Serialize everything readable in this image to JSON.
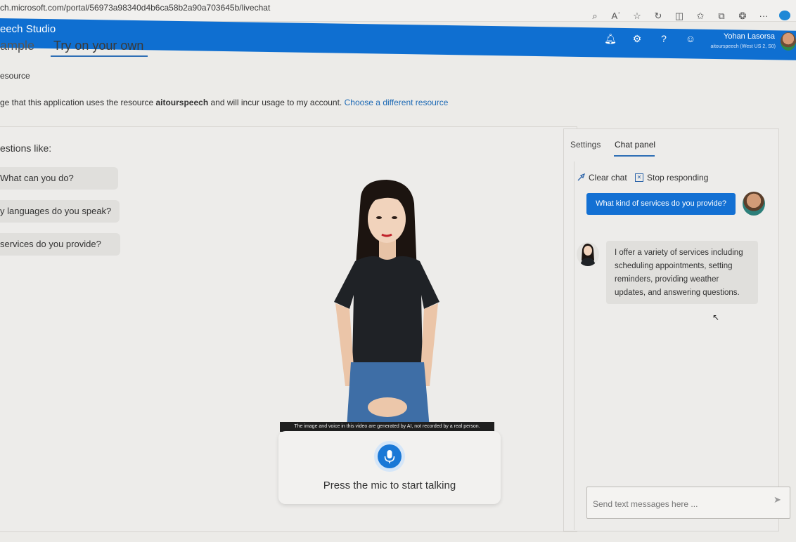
{
  "browser": {
    "url": "ch.microsoft.com/portal/56973a98340d4b6ca58b2a90a703645b/livechat",
    "icons": [
      "zoom-icon",
      "read-aloud-icon",
      "favorite-icon",
      "refresh-icon",
      "split-icon",
      "favorites-icon",
      "collections-icon",
      "extensions-icon",
      "more-icon",
      "edge-copilot-icon"
    ],
    "more_label": "···"
  },
  "header": {
    "app_name": "eech Studio",
    "icons": [
      "bell-icon",
      "gear-icon",
      "help-icon",
      "feedback-icon"
    ],
    "help_glyph": "?",
    "user_name": "Yohan Lasorsa",
    "user_resource": "aitourspeech (West US 2, S0)",
    "accent": "#0f6fd1"
  },
  "tabs": {
    "sample": "ample",
    "try_own": "Try on your own"
  },
  "resource": {
    "heading": "esource",
    "consent_prefix": "ge that this application uses the resource ",
    "resource_name": "aitourspeech",
    "consent_suffix": " and will incur usage to my account. ",
    "change_link": "Choose a different resource"
  },
  "left": {
    "questions_label": "estions like:",
    "questions": [
      "What can you do?",
      "y languages do you speak?",
      "services do you provide?"
    ],
    "caption": "The image and voice in this video are generated by AI, not recorded by a real person.",
    "mic_label": "Press the mic to start talking"
  },
  "chat": {
    "tab_settings": "Settings",
    "tab_chat": "Chat panel",
    "clear_chat": "Clear chat",
    "stop_responding": "Stop responding",
    "user_message": "What kind of services do you provide?",
    "bot_message": "I offer a variety of services including scheduling appointments, setting reminders, providing weather updates, and answering questions.",
    "input_placeholder": "Send text messages here ...",
    "send_glyph": "➤"
  }
}
